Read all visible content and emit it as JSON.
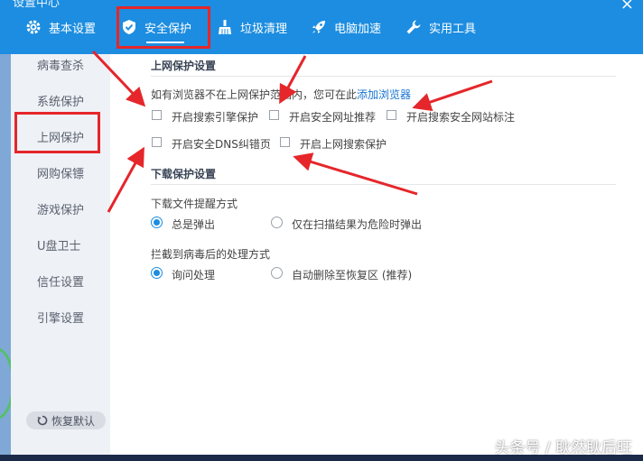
{
  "window": {
    "title_fragment": "设置中心",
    "close_glyph": "×"
  },
  "tabs": [
    {
      "label": "基本设置",
      "icon": "gear-icon"
    },
    {
      "label": "安全保护",
      "icon": "shield-check-icon"
    },
    {
      "label": "垃圾清理",
      "icon": "broom-icon"
    },
    {
      "label": "电脑加速",
      "icon": "rocket-icon"
    },
    {
      "label": "实用工具",
      "icon": "wrench-icon"
    }
  ],
  "sidebar": {
    "items": [
      {
        "label": "病毒查杀"
      },
      {
        "label": "系统保护"
      },
      {
        "label": "上网保护"
      },
      {
        "label": "网购保镖"
      },
      {
        "label": "游戏保护"
      },
      {
        "label": "U盘卫士"
      },
      {
        "label": "信任设置"
      },
      {
        "label": "引擎设置"
      }
    ],
    "restore_label": "恢复默认"
  },
  "web_protection": {
    "title": "上网保护设置",
    "note_prefix": "如有浏览器不在上网保护范围内，您可在此",
    "note_link": "添加浏览器",
    "options": [
      {
        "label": "开启搜索引擎保护",
        "checked": false
      },
      {
        "label": "开启安全网址推荐",
        "checked": false
      },
      {
        "label": "开启搜索安全网站标注",
        "checked": false
      },
      {
        "label": "开启安全DNS纠错页",
        "checked": false
      },
      {
        "label": "开启上网搜索保护",
        "checked": false
      }
    ]
  },
  "download_protection": {
    "title": "下载保护设置",
    "remind_label": "下载文件提醒方式",
    "remind_options": [
      {
        "label": "总是弹出",
        "selected": true
      },
      {
        "label": "仅在扫描结果为危险时弹出",
        "selected": false
      }
    ],
    "intercept_label": "拦截到病毒后的处理方式",
    "intercept_options": [
      {
        "label": "询问处理",
        "selected": true
      },
      {
        "label": "自动删除至恢复区 (推荐)",
        "selected": false
      }
    ]
  },
  "watermark": "头条号 / 耿然耿后旺",
  "colors": {
    "accent": "#1c8de0",
    "annotation": "#e5262a",
    "link": "#1874d2"
  }
}
